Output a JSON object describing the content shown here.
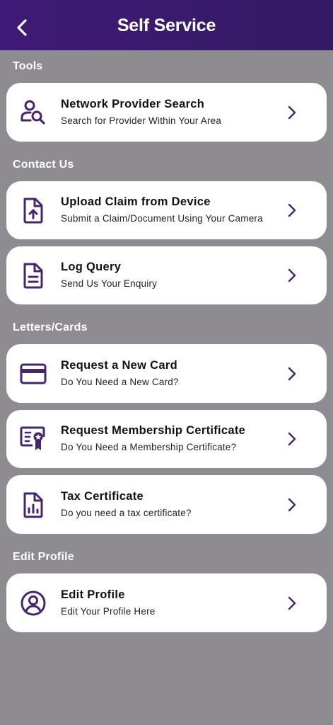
{
  "header": {
    "title": "Self Service",
    "back_icon": "chevron-left-icon"
  },
  "colors": {
    "header": "#3c1a70",
    "accent": "#45256b",
    "background": "#8e8c91",
    "card": "#ffffff"
  },
  "sections": {
    "tools": {
      "title": "Tools",
      "network_search": {
        "title": "Network Provider Search",
        "subtitle": "Search for Provider Within Your Area",
        "icon": "user-search-icon"
      }
    },
    "contact": {
      "title": "Contact Us",
      "upload_claim": {
        "title": "Upload Claim from Device",
        "subtitle": "Submit a Claim/Document Using Your Camera",
        "icon": "file-upload-icon"
      },
      "log_query": {
        "title": "Log Query",
        "subtitle": "Send Us Your Enquiry",
        "icon": "document-icon"
      }
    },
    "letters": {
      "title": "Letters/Cards",
      "new_card": {
        "title": "Request a New Card",
        "subtitle": "Do You Need a New Card?",
        "icon": "credit-card-icon"
      },
      "membership": {
        "title": "Request Membership Certificate",
        "subtitle": "Do You Need a Membership Certificate?",
        "icon": "certificate-icon"
      },
      "tax": {
        "title": "Tax Certificate",
        "subtitle": "Do you need a tax certificate?",
        "icon": "file-chart-icon"
      }
    },
    "profile": {
      "title": "Edit Profile",
      "edit_profile": {
        "title": "Edit Profile",
        "subtitle": "Edit Your Profile Here",
        "icon": "user-circle-icon"
      }
    }
  }
}
